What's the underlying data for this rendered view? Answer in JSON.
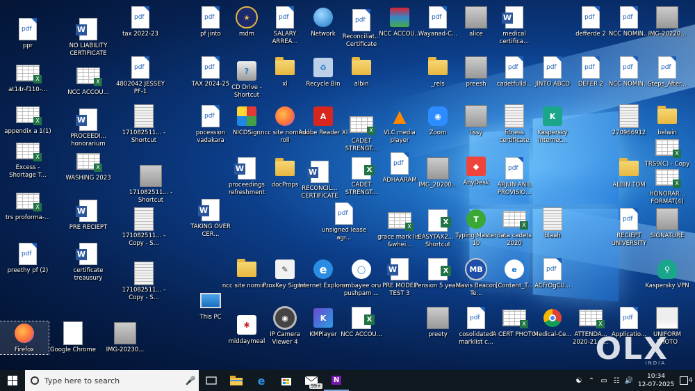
{
  "desktop": {
    "icons": [
      {
        "label": "ppr",
        "type": "pdf"
      },
      {
        "label": "at14r-f110-...",
        "type": "sheet"
      },
      {
        "label": "appendix a 1(1)",
        "type": "sheet"
      },
      {
        "label": "Excess - Shortage T...",
        "type": "sheet"
      },
      {
        "label": "trs proforma-...",
        "type": "sheet"
      },
      {
        "label": "preethy pf (2)",
        "type": "pdf"
      },
      {
        "label": "Firefox",
        "type": "firefox"
      },
      {
        "label": "NO LIABILITY CERTIFICATE",
        "type": "word"
      },
      {
        "label": "NCC ACCOU...",
        "type": "sheet"
      },
      {
        "label": "PROCEEDI... honorarium",
        "type": "word"
      },
      {
        "label": "WASHING 2023",
        "type": "sheet"
      },
      {
        "label": "PRE RECIEPT",
        "type": "word"
      },
      {
        "label": "certificate treausury",
        "type": "word"
      },
      {
        "label": "Google Chrome",
        "type": "doc"
      },
      {
        "label": "tax 2022-23",
        "type": "pdf"
      },
      {
        "label": "4802042 JESSEY PF-1",
        "type": "pdf"
      },
      {
        "label": "171082511... - Shortcut",
        "type": "docimg"
      },
      {
        "label": "171082511... - Shortcut",
        "type": "photo"
      },
      {
        "label": "171082511... - Copy - S...",
        "type": "docimg"
      },
      {
        "label": "171082511... - Copy - S...",
        "type": "docimg"
      },
      {
        "label": "IMG-20230...",
        "type": "photo"
      },
      {
        "label": "pf jinto",
        "type": "pdf"
      },
      {
        "label": "TAX 2024-25",
        "type": "pdf"
      },
      {
        "label": "pocession vadakara",
        "type": "pdf"
      },
      {
        "label": "TAKING OVER CER...",
        "type": "word"
      },
      {
        "label": "This PC",
        "type": "pc"
      },
      {
        "label": "mdm",
        "type": "mdm"
      },
      {
        "label": "CD Drive - Shortcut",
        "type": "cd"
      },
      {
        "label": "NICDSign",
        "type": "nicd"
      },
      {
        "label": "proceedings refreshment",
        "type": "word"
      },
      {
        "label": "ncc site nomin...",
        "type": "folder"
      },
      {
        "label": "middaymeal",
        "type": "midday"
      },
      {
        "label": "SALARY ARREA...",
        "type": "pdf"
      },
      {
        "label": "xl",
        "type": "folder"
      },
      {
        "label": "ncc site nominal roll",
        "type": "firefox"
      },
      {
        "label": "docProps",
        "type": "folder"
      },
      {
        "label": "ProxKey Signer",
        "type": "proxkey"
      },
      {
        "label": "IP Camera Viewer 4",
        "type": "ipcam"
      },
      {
        "label": "Network",
        "type": "network"
      },
      {
        "label": "Recycle Bin",
        "type": "recycle"
      },
      {
        "label": "Adobe Reader XI",
        "type": "adobe"
      },
      {
        "label": "RECONCIL... CERTIFICATE",
        "type": "word"
      },
      {
        "label": "Internet Explorer",
        "type": "ie"
      },
      {
        "label": "KMPlayer",
        "type": "kmp"
      },
      {
        "label": "Reconciliat... Certificate",
        "type": "pdf"
      },
      {
        "label": "albin",
        "type": "folder"
      },
      {
        "label": "CADET STRENGT...",
        "type": "sheet"
      },
      {
        "label": "CADET STRENGT...",
        "type": "excel"
      },
      {
        "label": "unsigned lease agr...",
        "type": "pdf"
      },
      {
        "label": "umbayee oru pushpam ...",
        "type": "umbayee"
      },
      {
        "label": "NCC ACCOU...",
        "type": "excel"
      },
      {
        "label": "NCC ACCOU...",
        "type": "winrar"
      },
      {
        "label": "VLC media player",
        "type": "vlc"
      },
      {
        "label": "ADHAARAM",
        "type": "pdf"
      },
      {
        "label": "grace mark list &whei...",
        "type": "sheet"
      },
      {
        "label": "PRE MODEL TEST 3",
        "type": "word"
      },
      {
        "label": "Wayanad-C...",
        "type": "pdf"
      },
      {
        "label": "_rels",
        "type": "folder"
      },
      {
        "label": "Zoom",
        "type": "zoom"
      },
      {
        "label": "IMG_20200...",
        "type": "photo"
      },
      {
        "label": "EASYTAX2... - Shortcut",
        "type": "excel"
      },
      {
        "label": "Pension 5 years",
        "type": "excel"
      },
      {
        "label": "preety",
        "type": "photo"
      },
      {
        "label": "alice",
        "type": "photo"
      },
      {
        "label": "preesh",
        "type": "photo"
      },
      {
        "label": "lissy",
        "type": "photo"
      },
      {
        "label": "AnyDesk",
        "type": "anydesk"
      },
      {
        "label": "Typing Master 10",
        "type": "typing"
      },
      {
        "label": "Mavis Beacon Te...",
        "type": "mavis"
      },
      {
        "label": "cosolidated marklist c...",
        "type": "pdf"
      },
      {
        "label": "medical certifica...",
        "type": "word"
      },
      {
        "label": "cadetfulld...",
        "type": "pdf"
      },
      {
        "label": "fitness certificate",
        "type": "docimg"
      },
      {
        "label": "ARJUN ANIL PROVISIO...",
        "type": "pdf"
      },
      {
        "label": "data cadets 2020",
        "type": "sheet"
      },
      {
        "label": "[Content_T...",
        "type": "ctypes"
      },
      {
        "label": "A CERT PHOTO",
        "type": "sheet"
      },
      {
        "label": "JINTO ABCD",
        "type": "pdf"
      },
      {
        "label": "Kaspersky Internet...",
        "type": "kaspersky"
      },
      {
        "label": "blaah",
        "type": "docimg"
      },
      {
        "label": "ACFrOgCU...",
        "type": "pdf"
      },
      {
        "label": "Medical-Ce...",
        "type": "chrome"
      },
      {
        "label": "defferde 2",
        "type": "pdf"
      },
      {
        "label": "DEFER 2",
        "type": "pdf"
      },
      {
        "label": "ATTENDA... 2020-21 - ...",
        "type": "sheet"
      },
      {
        "label": "NCC NOMIN...",
        "type": "pdf"
      },
      {
        "label": "NCC NOMIN...",
        "type": "pdf"
      },
      {
        "label": "270966912",
        "type": "docimg"
      },
      {
        "label": "ALBIN TOM",
        "type": "word-folder"
      },
      {
        "label": "RECIEPT UNIVERSITY",
        "type": "pdf"
      },
      {
        "label": "Applicatio...",
        "type": "pdf"
      },
      {
        "label": "IMG-20220...",
        "type": "photo"
      },
      {
        "label": "Steps_After...",
        "type": "pdf"
      },
      {
        "label": "belwin",
        "type": "folder"
      },
      {
        "label": "TRS9(C) - Copy",
        "type": "sheet"
      },
      {
        "label": "HONORAR... FORMAT(4)",
        "type": "sheet"
      },
      {
        "label": "SIGNATURE",
        "type": "photo"
      },
      {
        "label": "Kaspersky VPN",
        "type": "kvpn"
      },
      {
        "label": "UNIFORM PHOTO",
        "type": "portrait"
      }
    ],
    "watermark": "OLX",
    "watermark_sub": "INDIA"
  },
  "taskbar": {
    "search_placeholder": "Type here to search",
    "badge": "99+",
    "time": "10:34",
    "date": "12-07-2025",
    "notifications": "4"
  }
}
